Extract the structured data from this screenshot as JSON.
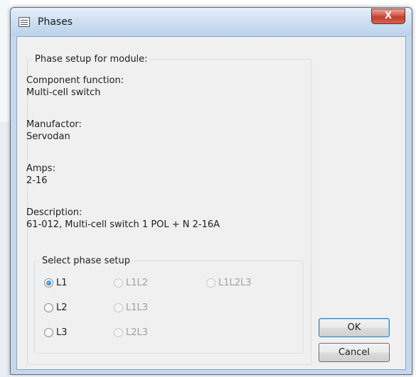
{
  "window": {
    "title": "Phases",
    "close_label": "X"
  },
  "module_group": {
    "legend": "Phase setup for module:",
    "fields": [
      {
        "label": "Component function:",
        "value": "Multi-cell switch"
      },
      {
        "label": "Manufactor:",
        "value": "Servodan"
      },
      {
        "label": "Amps:",
        "value": "2-16"
      },
      {
        "label": "Description:",
        "value": "61-012, Multi-cell switch 1 POL + N 2-16A"
      }
    ]
  },
  "phase_group": {
    "legend": "Select phase setup",
    "options": [
      {
        "label": "L1",
        "checked": true,
        "enabled": true
      },
      {
        "label": "L2",
        "checked": false,
        "enabled": true
      },
      {
        "label": "L3",
        "checked": false,
        "enabled": true
      },
      {
        "label": "L1L2",
        "checked": false,
        "enabled": false
      },
      {
        "label": "L1L3",
        "checked": false,
        "enabled": false
      },
      {
        "label": "L2L3",
        "checked": false,
        "enabled": false
      },
      {
        "label": "L1L2L3",
        "checked": false,
        "enabled": false
      }
    ]
  },
  "buttons": {
    "ok": "OK",
    "cancel": "Cancel"
  }
}
